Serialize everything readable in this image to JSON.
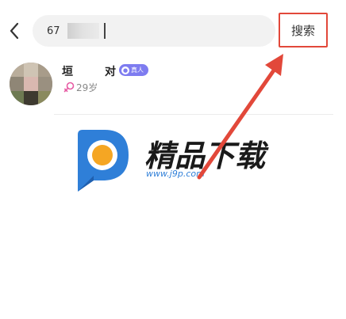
{
  "search": {
    "query": "67",
    "submit_label": "搜索"
  },
  "result": {
    "name_first": "垣",
    "name_last": "对",
    "badge_label": "真人",
    "badge_icon": "person-icon",
    "age": "29岁",
    "gender_icon": "female-icon"
  },
  "watermark": {
    "title": "精品下载",
    "url": "www.j9p.com"
  },
  "colors": {
    "highlight": "#e2483a",
    "badge": "#7e7cf0",
    "watermark_blue": "#2f7fd8",
    "watermark_orange": "#f5a623"
  }
}
